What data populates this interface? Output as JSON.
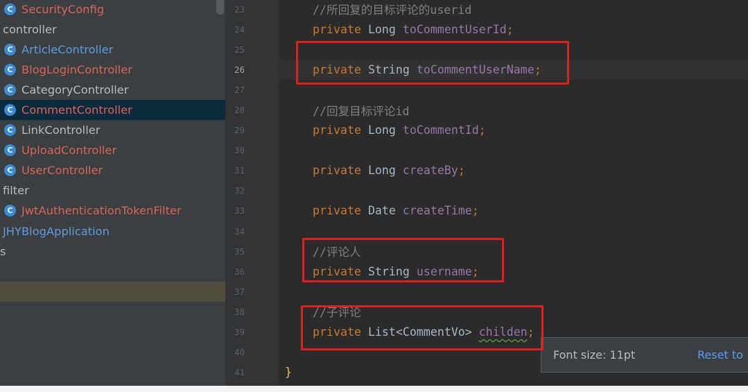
{
  "project_tree": {
    "class_icon_letter": "C",
    "items": [
      {
        "label": "SecurityConfig",
        "icon": "class-icon"
      },
      {
        "label": "controller"
      },
      {
        "label": "ArticleController",
        "icon": "class-icon"
      },
      {
        "label": "BlogLoginController",
        "icon": "class-icon"
      },
      {
        "label": "CategoryController",
        "icon": "class-icon"
      },
      {
        "label": "CommentController",
        "icon": "class-icon"
      },
      {
        "label": "LinkController",
        "icon": "class-icon"
      },
      {
        "label": "UploadController",
        "icon": "class-icon"
      },
      {
        "label": "UserController",
        "icon": "class-icon"
      },
      {
        "label": "filter"
      },
      {
        "label": "JwtAuthenticationTokenFilter",
        "icon": "class-icon"
      },
      {
        "label": "JHYBlogApplication"
      },
      {
        "label": "s"
      }
    ]
  },
  "editor": {
    "lines": [
      {
        "number": "23",
        "tokens": [
          "//所回复的目标评论的userid"
        ]
      },
      {
        "number": "24",
        "tokens": [
          "private ",
          "Long ",
          "toCommentUserId",
          ";"
        ]
      },
      {
        "number": "25",
        "tokens": []
      },
      {
        "number": "26",
        "tokens": [
          "private ",
          "String ",
          "toCommentUserName",
          ";"
        ]
      },
      {
        "number": "27",
        "tokens": []
      },
      {
        "number": "28",
        "tokens": [
          "//回复目标评论id"
        ]
      },
      {
        "number": "29",
        "tokens": [
          "private ",
          "Long ",
          "toCommentId",
          ";"
        ]
      },
      {
        "number": "30",
        "tokens": []
      },
      {
        "number": "31",
        "tokens": [
          "private ",
          "Long ",
          "createBy",
          ";"
        ]
      },
      {
        "number": "32",
        "tokens": []
      },
      {
        "number": "33",
        "tokens": [
          "private ",
          "Date ",
          "createTime",
          ";"
        ]
      },
      {
        "number": "34",
        "tokens": []
      },
      {
        "number": "35",
        "tokens": [
          "//评论人"
        ]
      },
      {
        "number": "36",
        "tokens": [
          "private ",
          "String ",
          "username",
          ";"
        ]
      },
      {
        "number": "37",
        "tokens": []
      },
      {
        "number": "38",
        "tokens": [
          "//子评论"
        ]
      },
      {
        "number": "39",
        "tokens": [
          "private ",
          "List<CommentVo> ",
          "childen",
          ";"
        ]
      },
      {
        "number": "40",
        "tokens": []
      },
      {
        "number": "41",
        "tokens": [
          "}"
        ]
      }
    ]
  },
  "popup": {
    "font_size_label": "Font size: 11pt",
    "reset_link": "Reset to"
  },
  "colors": {
    "unversioned_file": "#d8645a",
    "modified_file": "#5f9be0",
    "default_file": "#bbbbbb",
    "selection": "#0d293e",
    "keyword": "#cc7832",
    "field": "#9876aa",
    "comment": "#808080",
    "plain_code": "#a9b7c6",
    "annotation_box": "#e0201f",
    "link": "#589df6"
  }
}
